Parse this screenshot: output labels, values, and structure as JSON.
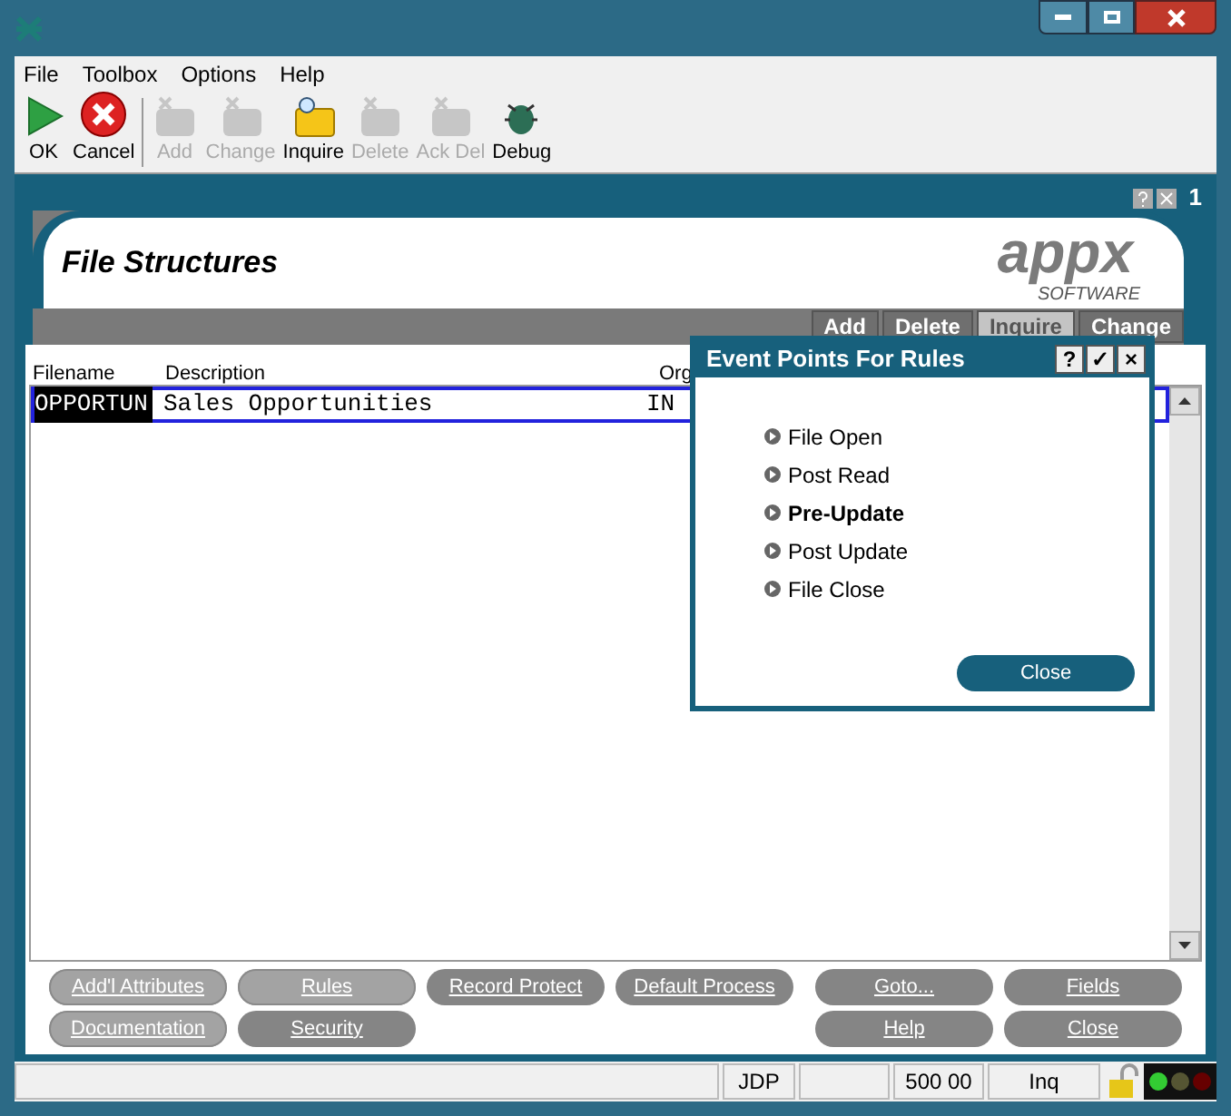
{
  "menu": [
    "File",
    "Toolbox",
    "Options",
    "Help"
  ],
  "toolbar": [
    {
      "label": "OK",
      "kind": "ok",
      "enabled": true
    },
    {
      "label": "Cancel",
      "kind": "cancel",
      "enabled": true
    },
    {
      "label": "Add",
      "kind": "add",
      "enabled": false
    },
    {
      "label": "Change",
      "kind": "change",
      "enabled": false
    },
    {
      "label": "Inquire",
      "kind": "inquire",
      "enabled": true
    },
    {
      "label": "Delete",
      "kind": "delete",
      "enabled": false
    },
    {
      "label": "Ack Del",
      "kind": "ackdel",
      "enabled": false
    },
    {
      "label": "Debug",
      "kind": "debug",
      "enabled": true
    }
  ],
  "frame": {
    "number": "1",
    "title": "File Structures",
    "logo": "appx",
    "logo_sub": "SOFTWARE"
  },
  "modes": [
    {
      "label": "Add",
      "selected": false
    },
    {
      "label": "Delete",
      "selected": false
    },
    {
      "label": "Inquire",
      "selected": true
    },
    {
      "label": "Change",
      "selected": false
    }
  ],
  "table": {
    "columns": [
      "Filename",
      "Description",
      "Org"
    ],
    "rows": [
      {
        "cells": [
          "OPPORTUN",
          "Sales Opportunities",
          "IN"
        ],
        "selected": true
      }
    ]
  },
  "dialog": {
    "title": "Event Points For Rules",
    "title_buttons": [
      "?",
      "✓",
      "×"
    ],
    "items": [
      {
        "label": "File Open",
        "selected": false
      },
      {
        "label": "Post Read",
        "selected": false
      },
      {
        "label": "Pre-Update",
        "selected": true
      },
      {
        "label": "Post Update",
        "selected": false
      },
      {
        "label": "File Close",
        "selected": false
      }
    ],
    "close": "Close"
  },
  "buttons_left": [
    [
      {
        "label": "Add'l Attributes",
        "highlighted": true
      },
      {
        "label": "Rules",
        "highlighted": true
      },
      {
        "label": "Record Protect",
        "highlighted": false
      },
      {
        "label": "Default Process",
        "highlighted": false
      }
    ],
    [
      {
        "label": "Documentation",
        "highlighted": true
      },
      {
        "label": "Security",
        "highlighted": false
      }
    ]
  ],
  "buttons_right": [
    [
      {
        "label": "Goto...",
        "highlighted": false
      },
      {
        "label": "Fields",
        "highlighted": false
      }
    ],
    [
      {
        "label": "Help",
        "highlighted": false
      },
      {
        "label": "Close",
        "highlighted": false
      }
    ]
  ],
  "status_bar": {
    "user": "JDP",
    "code": "500 00",
    "mode": "Inq"
  }
}
